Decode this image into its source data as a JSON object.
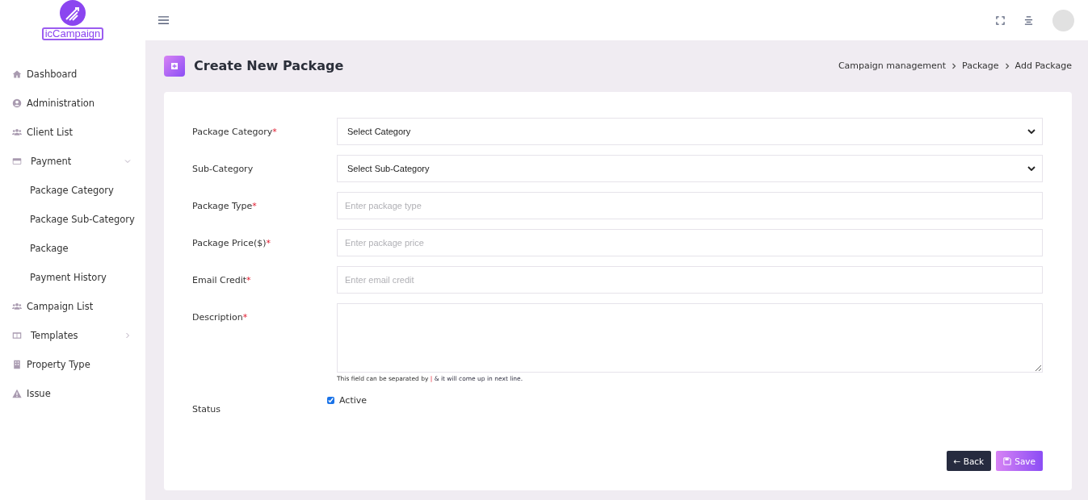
{
  "brand": {
    "name": "icCampaign"
  },
  "sidebar": {
    "items": [
      {
        "label": "Dashboard",
        "kind": "link"
      },
      {
        "label": "Administration",
        "kind": "link"
      },
      {
        "label": "Client List",
        "kind": "link"
      },
      {
        "label": "Payment",
        "kind": "group",
        "expanded": true,
        "children": [
          {
            "label": "Package Category"
          },
          {
            "label": "Package Sub-Category"
          },
          {
            "label": "Package"
          },
          {
            "label": "Payment History"
          }
        ]
      },
      {
        "label": "Campaign List",
        "kind": "link"
      },
      {
        "label": "Templates",
        "kind": "group",
        "expanded": false
      },
      {
        "label": "Property Type",
        "kind": "link"
      },
      {
        "label": "Issue",
        "kind": "link"
      }
    ]
  },
  "page": {
    "title": "Create New Package",
    "breadcrumb": [
      "Campaign management",
      "Package",
      "Add Package"
    ]
  },
  "form": {
    "fields": [
      {
        "label": "Package Category",
        "required_mark": "*",
        "kind": "select",
        "value": "Select Category"
      },
      {
        "label": "Sub-Category",
        "kind": "select",
        "value": "Select Sub-Category"
      },
      {
        "label": "Package Type",
        "required_mark": "*",
        "kind": "input",
        "placeholder": "Enter package type"
      },
      {
        "label": "Package Price($)",
        "required_mark": "*",
        "kind": "input",
        "placeholder": "Enter package price"
      },
      {
        "label": "Email Credit",
        "required_mark": "*",
        "kind": "input",
        "placeholder": "Enter email credit"
      },
      {
        "label": "Description",
        "required_mark": "*",
        "kind": "textarea",
        "help": {
          "before": "This field can be separated by",
          "separator": "|",
          "after": "& it will come up in next line."
        }
      },
      {
        "label": "Status",
        "kind": "checkbox",
        "option": "Active",
        "checked": true
      }
    ],
    "buttons": [
      {
        "label": "← Back",
        "kind": "back"
      },
      {
        "label": "Save",
        "kind": "save"
      }
    ]
  }
}
